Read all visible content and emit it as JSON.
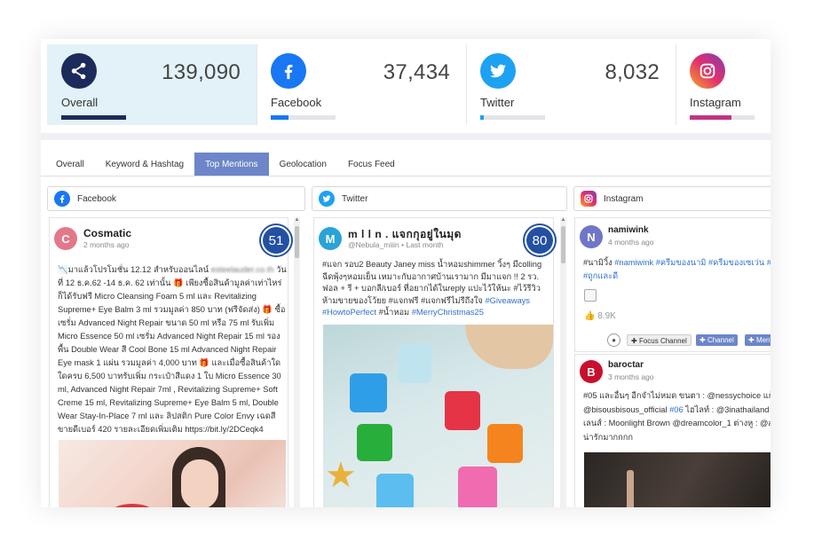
{
  "stats": [
    {
      "label": "Overall",
      "value": "139,090",
      "icon": "share-icon",
      "color": "#1c2a5c",
      "bar_fraction": 1.0
    },
    {
      "label": "Facebook",
      "value": "37,434",
      "icon": "facebook-icon",
      "color": "#1877f2",
      "bar_fraction": 0.27
    },
    {
      "label": "Twitter",
      "value": "8,032",
      "icon": "twitter-icon",
      "color": "#1da1f2",
      "bar_fraction": 0.06
    },
    {
      "label": "Instagram",
      "value": "",
      "icon": "instagram-icon",
      "color": "#c13584",
      "bar_fraction": 0.65
    }
  ],
  "tabs": [
    "Overall",
    "Keyword & Hashtag",
    "Top Mentions",
    "Geolocation",
    "Focus Feed"
  ],
  "active_tab": "Top Mentions",
  "columns": {
    "facebook": {
      "header": "Facebook",
      "post": {
        "avatar_letter": "C",
        "avatar_color": "#e3788a",
        "name": "Cosmatic",
        "time": "2 months ago",
        "score": "51",
        "text_1": "📉มาแล้วโปรโมชั่น 12.12 สำหรับออนไลน์",
        "text_blur": "esteelauder.co.th",
        "text_2": " วันที่ 12 ธ.ค.62 -14 ธ.ค. 62 เท่านั้น 🎁 เพียงซื้อสินค้ามูลค่าเท่าไหร่ก็ได้รับฟรี Micro Cleansing Foam 5 ml และ Revitalizing Supreme+ Eye Balm 3 ml รวมมูลค่า 850 บาท (ฟรีจัดส่ง) 🎁 ซื้อเซรั่ม Advanced Night Repair ขนาด 50 ml หรือ 75 ml รับเพิ่ม Micro Essence 50 ml เซรั่ม Advanced Night Repair 15 ml รองพื้น Double Wear สี Cool Bone 15 ml Advanced Night Repair Eye mask 1 แผ่น รวมมูลค่า 4,000 บาท 🎁 และเมื่อซื้อสินค้าใดใดครบ 6,500 บาทรับเพิ่ม กระเป๋าสีแดง 1 ใบ Micro Essence 30 ml, Advanced Night Repair 7ml , Revitalizing Supreme+ Soft Creme 15 ml, Revitalizing Supreme+ Eye Balm 5 ml, Double Wear Stay-In-Place 7 ml และ ลิปสติก Pure Color Envy เฉดสีขายดีเบอร์ 420 รายละเอียดเพิ่มเติม https://bit.ly/2DCeqk4"
      }
    },
    "twitter": {
      "header": "Twitter",
      "post": {
        "avatar_letter": "M",
        "avatar_color": "#2aa3d9",
        "name": "m l l n . แจกกุอยู่ในมุด",
        "handle": "@Nebula_miiin",
        "time": "Last month",
        "score": "80",
        "text": "#แจก รอบ2 Beauty Janey miss น้ำหอมshimmer วิ้งๆ มีcolling ฉีดพุ้งๆหอมเย็น เหมาะกับอากาศบ้านเรามาก มีมาแจก !! 2 รว. ฟอล + รี + บอกลี/เบอร์ ที่อยากได้ในreply แปะไว้ให้นะ #ไว้รีวิวห้ามขายของโว้ยย #แจกฟรี #แจกฟรีไม่รีถึงใจ",
        "tags": "#Giveaways #HowtoPerfect",
        "text_end": "#น้ำหอม",
        "tag_end": "#MerryChristmas25"
      }
    },
    "instagram": {
      "header": "Instagram",
      "post1": {
        "avatar_letter": "N",
        "avatar_color": "#6f76c7",
        "name": "namiwink",
        "time": "4 months ago",
        "text_plain": "#นามิวิ้ง",
        "tags": "#namiwink #ครีมของนามิ #ครีมของเซเว่น #",
        "tags2": "#ถูกและดี",
        "likes": "8.9K",
        "btn_focus": "Focus Channel",
        "btn_channel": "Channel",
        "btn_mention": "Menti"
      },
      "post2": {
        "avatar_letter": "B",
        "avatar_color": "#c8102e",
        "name": "baroctar",
        "time": "3 months ago",
        "text_1": "#05 และอื่นๆ อีกจำไม่หมด ขนตา : @nessychoice แก้ม",
        "text_2a": "@bisousbisous_official ",
        "text_2tag": "#06",
        "text_2b": " ไฮไลท์ : @3inathailand",
        "text_3": "เลนส์ : Moonlight Brown @dreamcolor_1 ต่างหู : @a",
        "text_4": "น่ารักมากกกก"
      }
    }
  }
}
